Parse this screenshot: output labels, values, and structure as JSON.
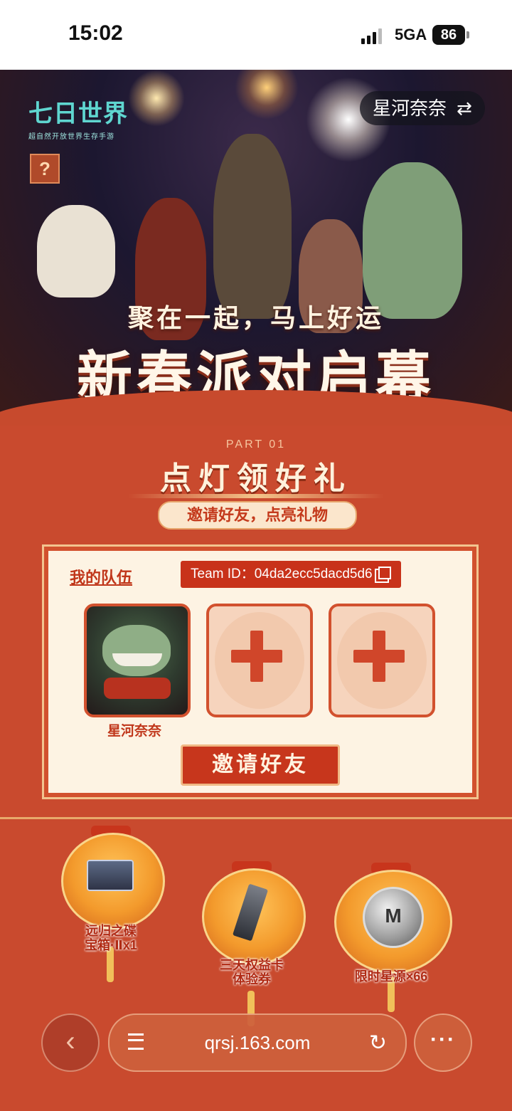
{
  "status_bar": {
    "time": "15:02",
    "network": "5GA",
    "battery": "86"
  },
  "hero": {
    "logo_text": "七日世界",
    "logo_sub": "超自然开放世界生存手游",
    "help_label": "?",
    "account_name": "星河奈奈",
    "swap_icon": "⇄",
    "tagline": "聚在一起，马上好运",
    "title": "新春派对启幕"
  },
  "section": {
    "part_label": "PART 01",
    "title": "点灯领好礼",
    "subtitle": "邀请好友，点亮礼物"
  },
  "team": {
    "label": "我的队伍",
    "team_id": "Team ID：04da2ecc5dacd5d6",
    "member_name": "星河奈奈",
    "invite_label": "邀请好友"
  },
  "rewards": [
    {
      "label": "远归之碟\n宝箱·Ⅱx1",
      "icon": "chest-icon"
    },
    {
      "label": "三天权益卡\n体验券",
      "icon": "card-icon"
    },
    {
      "label": "限时星源×66",
      "icon": "coin-icon"
    }
  ],
  "browser": {
    "url": "qrsj.163.com",
    "back_icon": "‹",
    "reload_icon": "↻",
    "more_icon": "···"
  },
  "colors": {
    "accent": "#c8321a",
    "panel_bg": "#fdf3e3",
    "logo": "#5fd6d0"
  }
}
